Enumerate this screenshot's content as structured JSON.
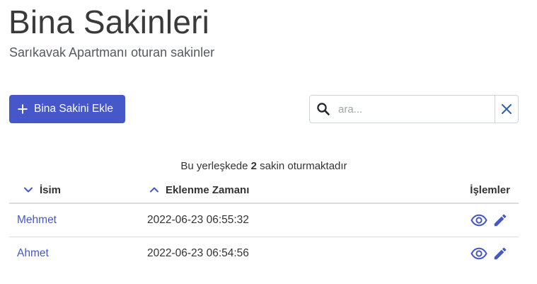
{
  "header": {
    "title": "Bina Sakinleri",
    "subtitle": "Sarıkavak Apartmanı oturan sakinler"
  },
  "toolbar": {
    "add_label": "Bina Sakini Ekle",
    "search_placeholder": "ara...",
    "search_value": ""
  },
  "summary": {
    "prefix": "Bu yerleşkede",
    "count": "2",
    "suffix": "sakin oturmaktadır"
  },
  "table": {
    "columns": {
      "name": "İsim",
      "date": "Eklenme Zamanı",
      "actions": "İşlemler"
    },
    "rows": [
      {
        "name": "Mehmet",
        "date": "2022-06-23 06:55:32"
      },
      {
        "name": "Ahmet",
        "date": "2022-06-23 06:54:56"
      }
    ]
  },
  "icons": {
    "add": "plus-icon",
    "search": "search-icon",
    "clear": "close-icon",
    "sort_name": "chevron-down-icon",
    "sort_date": "chevron-up-icon",
    "view": "eye-icon",
    "edit": "pencil-icon"
  },
  "colors": {
    "primary": "#4657c9",
    "text": "#333333",
    "muted": "#555a60"
  }
}
